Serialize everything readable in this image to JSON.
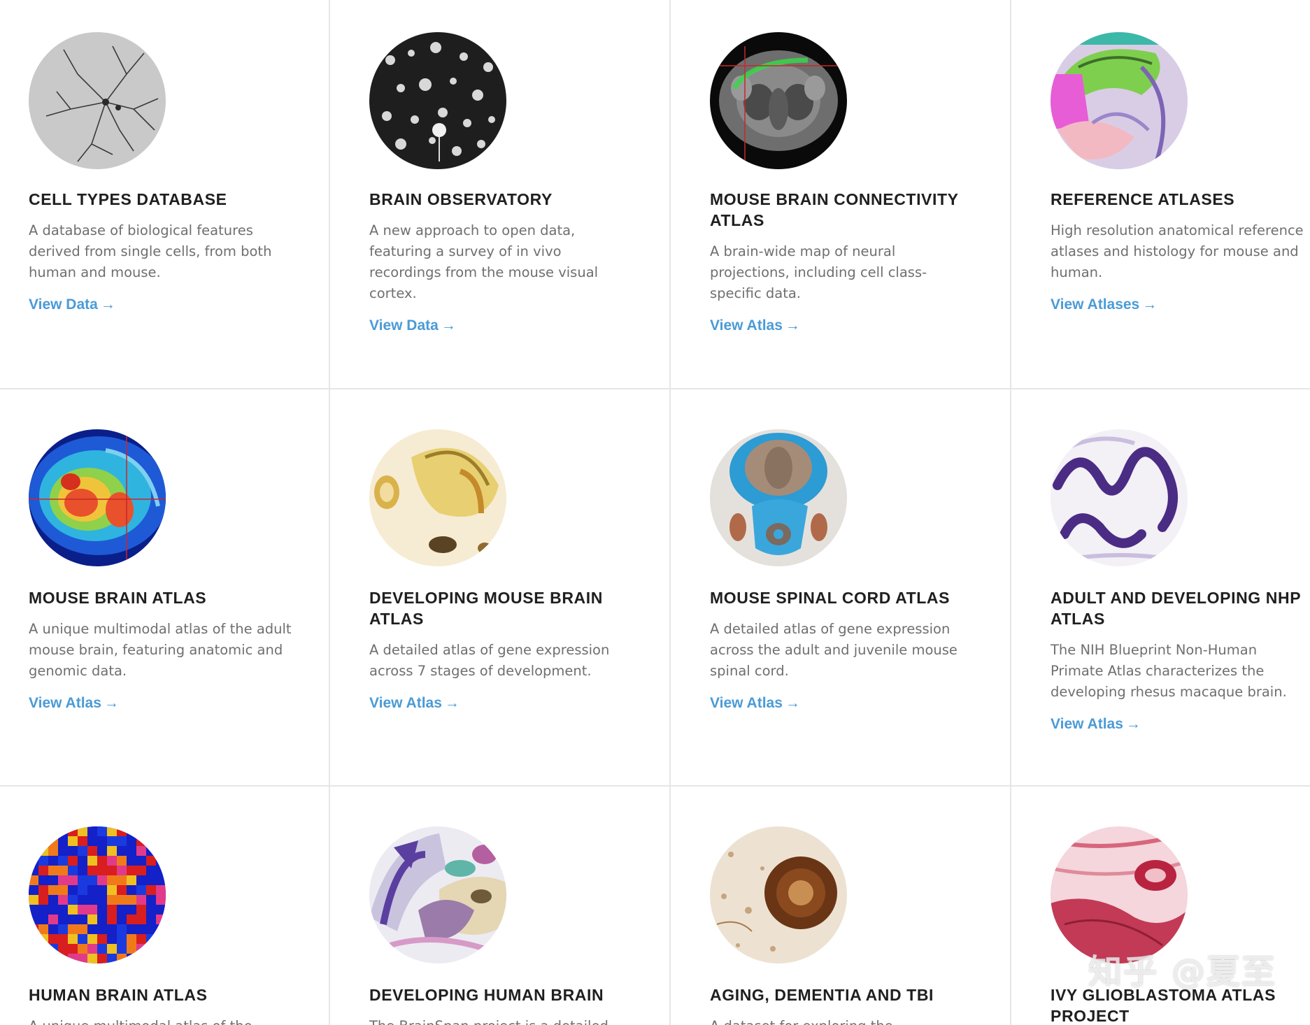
{
  "cards": [
    {
      "title": "CELL TYPES DATABASE",
      "description": "A database of biological features derived from single cells, from both human and mouse.",
      "link": "View Data",
      "icon": "neuron-image"
    },
    {
      "title": "BRAIN OBSERVATORY",
      "description": "A new approach to open data, featuring a survey of in vivo recordings from the mouse visual cortex.",
      "link": "View Data",
      "icon": "neuron-field-image"
    },
    {
      "title": "MOUSE BRAIN CONNECTIVITY ATLAS",
      "description": "A brain-wide map of neural projections, including cell class-specific data.",
      "link": "View Atlas",
      "icon": "brain-mri-image"
    },
    {
      "title": "REFERENCE ATLASES",
      "description": "High resolution anatomical reference atlases and histology for mouse and human.",
      "link": "View Atlases",
      "icon": "annotated-section-image"
    },
    {
      "title": "MOUSE BRAIN ATLAS",
      "description": "A unique multimodal atlas of the adult mouse brain, featuring anatomic and genomic data.",
      "link": "View Atlas",
      "icon": "heatmap-brain-image"
    },
    {
      "title": "DEVELOPING MOUSE BRAIN ATLAS",
      "description": "A detailed atlas of gene expression across 7 stages of development.",
      "link": "View Atlas",
      "icon": "embryo-section-image"
    },
    {
      "title": "MOUSE SPINAL CORD ATLAS",
      "description": "A detailed atlas of gene expression across the adult and juvenile mouse spinal cord.",
      "link": "View Atlas",
      "icon": "spinal-cord-image"
    },
    {
      "title": "ADULT AND DEVELOPING NHP ATLAS",
      "description": "The NIH Blueprint Non-Human Primate Atlas characterizes the developing rhesus macaque brain.",
      "link": "View Atlas",
      "icon": "cortex-stain-image"
    },
    {
      "title": "HUMAN BRAIN ATLAS",
      "description": "A unique multimodal atlas of the",
      "link": "",
      "icon": "microarray-heatmap-image"
    },
    {
      "title": "DEVELOPING HUMAN BRAIN",
      "description": "The BrainSpan project is a detailed",
      "link": "",
      "icon": "human-brain-section-image"
    },
    {
      "title": "AGING, DEMENTIA AND TBI",
      "description": "A dataset for exploring the",
      "link": "",
      "icon": "plaque-stain-image"
    },
    {
      "title": "IVY GLIOBLASTOMA ATLAS PROJECT",
      "description": "",
      "link": "",
      "icon": "tumor-histology-image"
    }
  ],
  "watermark": "知乎 @夏至",
  "colors": {
    "link": "#4a9bd6",
    "title": "#1f1f1f",
    "text": "#6f6f6f",
    "divider": "#e6e6e6"
  }
}
